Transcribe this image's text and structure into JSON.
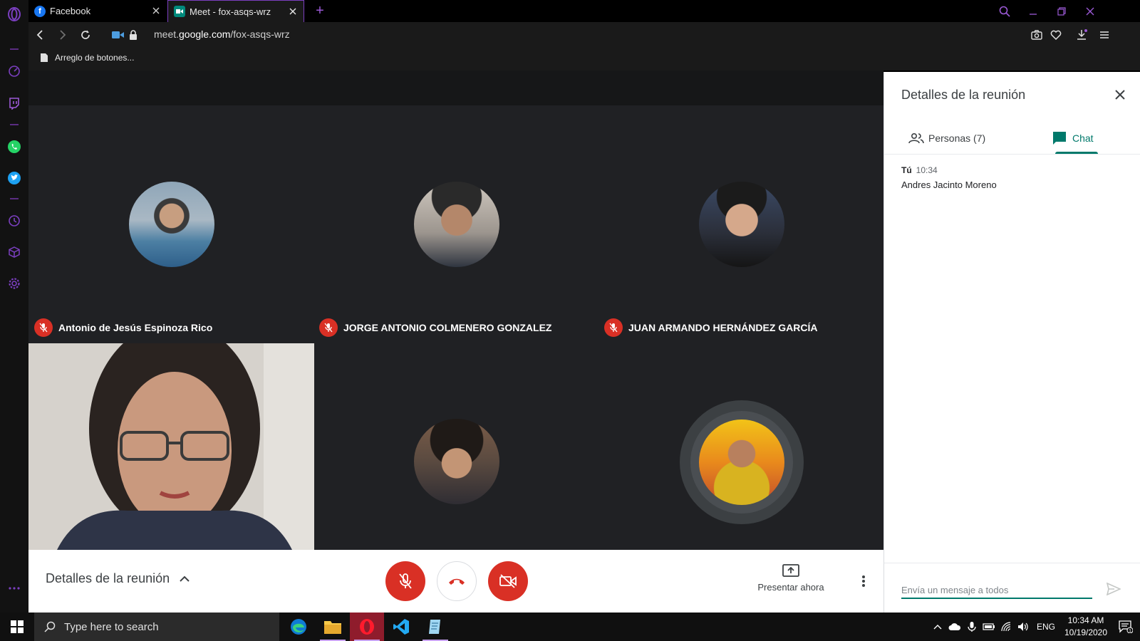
{
  "browser": {
    "tabs": [
      {
        "title": "Facebook",
        "favicon": "facebook-icon",
        "active": false
      },
      {
        "title": "Meet - fox-asqs-wrz",
        "favicon": "meet-icon",
        "active": true
      }
    ],
    "url_prefix": "meet.",
    "url_domain": "google.com",
    "url_path": "/fox-asqs-wrz",
    "bookmarks": [
      {
        "label": "Arreglo de botones..."
      }
    ]
  },
  "meeting": {
    "participants": [
      {
        "name": "Antonio de Jesús Espinoza Rico",
        "muted": true
      },
      {
        "name": "JORGE ANTONIO COLMENERO GONZALEZ",
        "muted": true
      },
      {
        "name": "JUAN ARMANDO HERNÁNDEZ GARCÍA",
        "muted": true
      }
    ],
    "bottom_bar": {
      "details_label": "Detalles de la reunión",
      "present_label": "Presentar ahora"
    }
  },
  "panel": {
    "title": "Detalles de la reunión",
    "tabs": [
      {
        "label": "Personas (7)",
        "active": false
      },
      {
        "label": "Chat",
        "active": true
      }
    ],
    "messages": [
      {
        "sender": "Tú",
        "time": "10:34",
        "text": "Andres Jacinto Moreno"
      }
    ],
    "input_placeholder": "Envía un mensaje a todos"
  },
  "taskbar": {
    "search_placeholder": "Type here to search",
    "language": "ENG",
    "time": "10:34 AM",
    "date": "10/19/2020",
    "notification_count": "1"
  },
  "colors": {
    "accent_teal": "#00796b",
    "danger_red": "#d93025",
    "opera_purple": "#9b59d6",
    "stage_bg": "#202124"
  }
}
